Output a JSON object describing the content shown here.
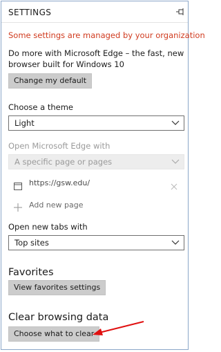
{
  "panel": {
    "title": "SETTINGS",
    "managed_notice": "Some settings are managed by your organization",
    "promo_text": "Do more with Microsoft Edge – the fast, new browser built for Windows 10",
    "change_default_label": "Change my default"
  },
  "theme": {
    "label": "Choose a theme",
    "selected": "Light"
  },
  "startup": {
    "label": "Open Microsoft Edge with",
    "selected": "A specific page or pages",
    "pages": [
      {
        "url": "https://gsw.edu/"
      }
    ],
    "add_page_label": "Add new page"
  },
  "new_tabs": {
    "label": "Open new tabs with",
    "selected": "Top sites"
  },
  "favorites": {
    "title": "Favorites",
    "button_label": "View favorites settings"
  },
  "clear_data": {
    "title": "Clear browsing data",
    "button_label": "Choose what to clear"
  },
  "icons": {
    "pin": "pin-icon",
    "chevron": "chevron-down-icon",
    "page": "page-icon",
    "remove": "close-icon",
    "add": "plus-icon",
    "annotation": "red-arrow-icon"
  },
  "colors": {
    "managed_notice": "#d03b1f",
    "button_bg": "#cccccc",
    "annotation_arrow": "#e01010",
    "frame_border": "#8aa6c8"
  }
}
